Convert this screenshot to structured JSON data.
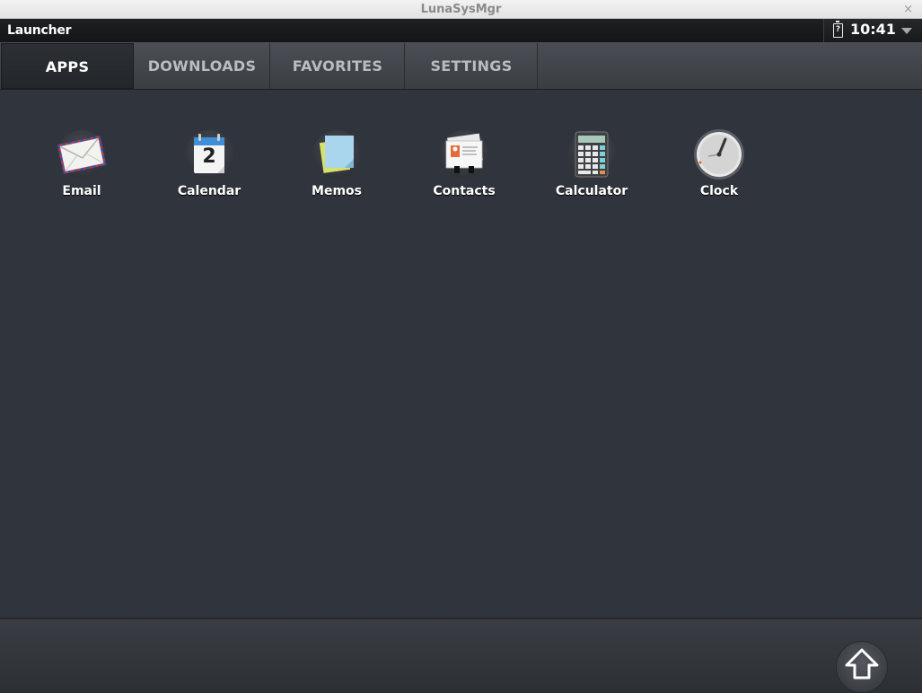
{
  "window": {
    "title": "LunaSysMgr",
    "close_glyph": "×"
  },
  "statusbar": {
    "title": "Launcher",
    "time": "10:41",
    "battery_glyph": "?",
    "battery_icon": "battery-icon",
    "menu_icon": "chevron-down-icon"
  },
  "tabs": [
    {
      "label": "APPS",
      "active": true
    },
    {
      "label": "DOWNLOADS",
      "active": false
    },
    {
      "label": "FAVORITES",
      "active": false
    },
    {
      "label": "SETTINGS",
      "active": false
    }
  ],
  "apps": [
    {
      "label": "Email",
      "icon": "envelope-icon"
    },
    {
      "label": "Calendar",
      "icon": "calendar-icon",
      "icon_text": "2"
    },
    {
      "label": "Memos",
      "icon": "memo-note-icon"
    },
    {
      "label": "Contacts",
      "icon": "contact-card-icon"
    },
    {
      "label": "Calculator",
      "icon": "calculator-icon"
    },
    {
      "label": "Clock",
      "icon": "clock-icon"
    }
  ],
  "bottombar": {
    "home_icon": "home-arrow-icon"
  },
  "colors": {
    "background": "#30343c",
    "tab_active": "#23262a",
    "status_bar": "#141517"
  }
}
